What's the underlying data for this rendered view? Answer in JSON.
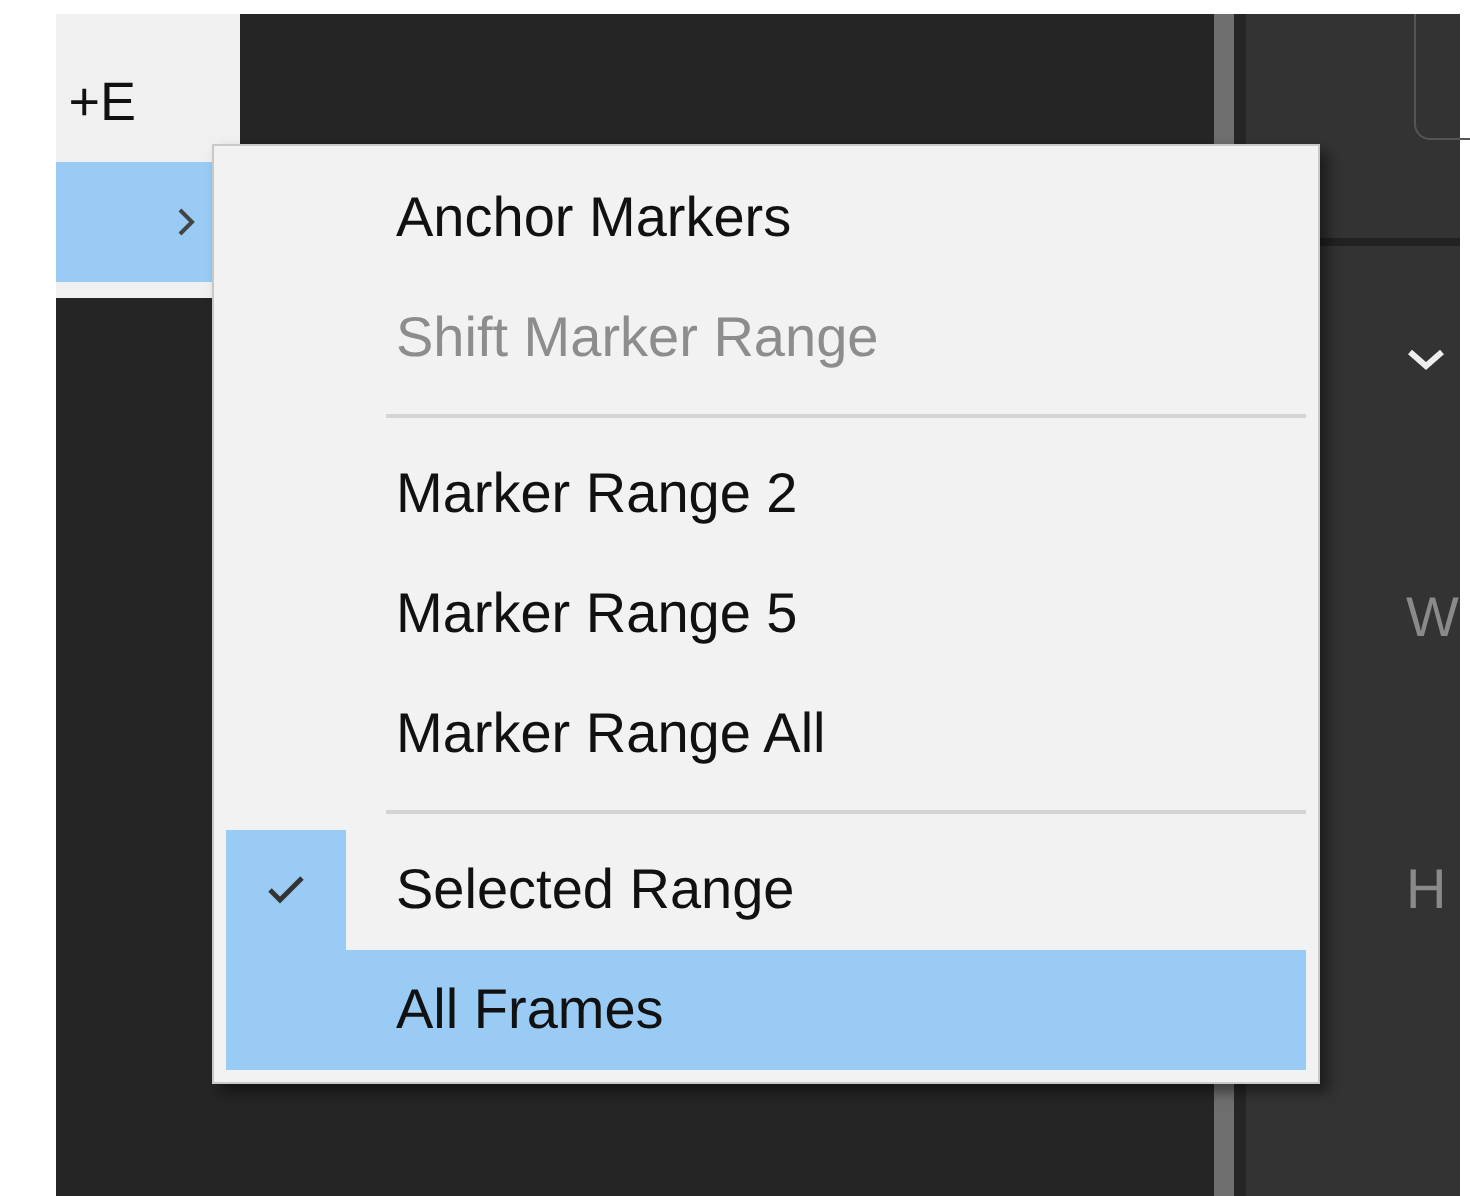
{
  "parent_menu": {
    "items": [
      {
        "shortcut": "+E",
        "highlighted": false,
        "has_submenu": false
      },
      {
        "highlighted": true,
        "has_submenu": true
      }
    ]
  },
  "submenu": {
    "items": [
      {
        "kind": "item",
        "label": "Anchor Markers",
        "disabled": false,
        "checked": false,
        "highlighted": false
      },
      {
        "kind": "item",
        "label": "Shift Marker Range",
        "disabled": true,
        "checked": false,
        "highlighted": false
      },
      {
        "kind": "separator"
      },
      {
        "kind": "item",
        "label": "Marker Range 2",
        "disabled": false,
        "checked": false,
        "highlighted": false
      },
      {
        "kind": "item",
        "label": "Marker Range 5",
        "disabled": false,
        "checked": false,
        "highlighted": false
      },
      {
        "kind": "item",
        "label": "Marker Range All",
        "disabled": false,
        "checked": false,
        "highlighted": false
      },
      {
        "kind": "separator"
      },
      {
        "kind": "item",
        "label": "Selected Range",
        "disabled": false,
        "checked": true,
        "highlighted": false
      },
      {
        "kind": "item",
        "label": "All Frames",
        "disabled": false,
        "checked": false,
        "highlighted": true
      }
    ]
  },
  "side_panel": {
    "labels": [
      "W",
      "H"
    ]
  }
}
